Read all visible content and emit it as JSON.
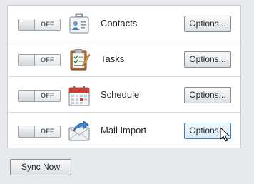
{
  "sync_items": [
    {
      "label": "Contacts",
      "toggle_state": "OFF",
      "options_label": "Options...",
      "icon": "contacts-card-icon"
    },
    {
      "label": "Tasks",
      "toggle_state": "OFF",
      "options_label": "Options...",
      "icon": "tasks-clipboard-icon"
    },
    {
      "label": "Schedule",
      "toggle_state": "OFF",
      "options_label": "Options...",
      "icon": "schedule-calendar-icon"
    },
    {
      "label": "Mail Import",
      "toggle_state": "OFF",
      "options_label": "Options...",
      "icon": "mail-import-envelope-icon"
    }
  ],
  "footer": {
    "sync_now_label": "Sync Now"
  },
  "colors": {
    "background": "#e7e9ec",
    "panel": "#ffffff",
    "hover_border": "#3c7fb1",
    "calendar_red": "#d23a32"
  }
}
